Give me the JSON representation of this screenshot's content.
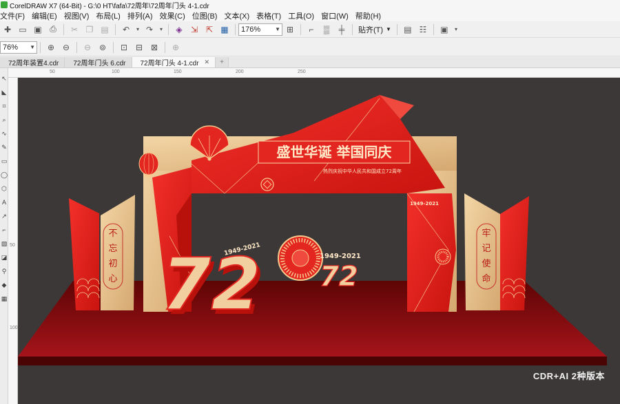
{
  "window": {
    "title": "CorelDRAW X7 (64-Bit) - G:\\0 HT\\fafa\\72周年\\72周年门头 4-1.cdr"
  },
  "menu": [
    "文件(F)",
    "编辑(E)",
    "视图(V)",
    "布局(L)",
    "排列(A)",
    "效果(C)",
    "位图(B)",
    "文本(X)",
    "表格(T)",
    "工具(O)",
    "窗口(W)",
    "帮助(H)"
  ],
  "toolbar": {
    "zoom_value": "176%",
    "snap_label": "贴齐(T)"
  },
  "zoombar": {
    "zoom_value": "76%"
  },
  "tabs": [
    {
      "label": "72周年装置4.cdr"
    },
    {
      "label": "72周年门头 6.cdr"
    },
    {
      "label": "72周年门头 4-1.cdr"
    }
  ],
  "ruler": {
    "h_ticks": [
      "50",
      "100",
      "150",
      "200",
      "250"
    ],
    "v_ticks": [
      "50",
      "100"
    ]
  },
  "artwork": {
    "headline": "盛世华诞 举国同庆",
    "subtitle": "热烈庆祝中华人民共和国成立72周年",
    "years_small": "1949-2021",
    "big_number": "72",
    "years_center": "1949-2021",
    "left_pillar_text": [
      "不",
      "忘",
      "初",
      "心"
    ],
    "right_pillar_text": [
      "牢",
      "记",
      "使",
      "命"
    ],
    "arch_years": "1949-2021"
  },
  "watermark": "CDR+AI 2种版本",
  "colors": {
    "canvas_bg": "#3c3838",
    "red": "#e8231b",
    "gold": "#e6be8a",
    "dark_red": "#7a0c0c"
  }
}
